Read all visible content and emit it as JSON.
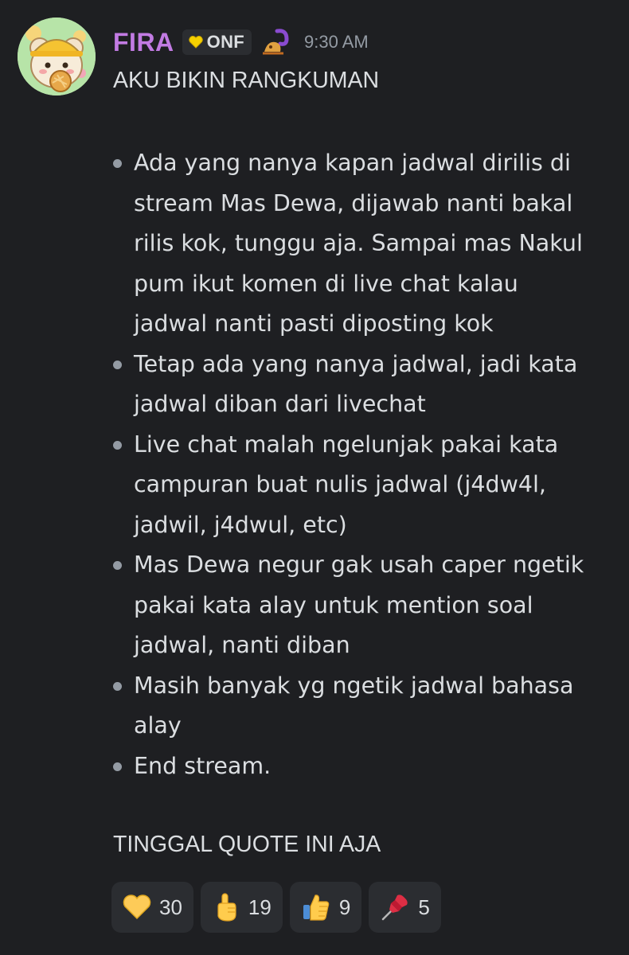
{
  "message": {
    "username": "FIRA",
    "username_color": "#c27be3",
    "clan_tag": "ONF",
    "timestamp": "9:30 AM",
    "heading": "AKU BIKIN RANGKUMAN",
    "bullets": [
      [
        "Ada yang nanya kapan jadwal dirilis di",
        "stream Mas Dewa, dijawab nanti bakal",
        "rilis kok, tunggu aja. Sampai mas Nakul",
        "pum ikut komen di live chat kalau",
        "jadwal nanti pasti diposting kok"
      ],
      [
        "Tetap ada yang nanya jadwal, jadi kata",
        "jadwal diban dari livechat"
      ],
      [
        "Live chat malah ngelunjak pakai kata",
        "campuran buat nulis jadwal (j4dw4l,",
        "jadwil, j4dwul, etc)"
      ],
      [
        "Mas Dewa negur gak usah caper ngetik",
        "pakai kata alay untuk mention soal",
        "jadwal, nanti diban"
      ],
      [
        "Masih banyak yg ngetik jadwal bahasa",
        "alay"
      ],
      [
        "End stream."
      ]
    ],
    "footer": "TINGGAL QUOTE INI AJA"
  },
  "reactions": [
    {
      "emoji": "yellow-heart-icon",
      "count": "30"
    },
    {
      "emoji": "pointing-up-icon",
      "count": "19"
    },
    {
      "emoji": "thumbs-up-icon",
      "count": "9"
    },
    {
      "emoji": "pushpin-icon",
      "count": "5"
    }
  ],
  "colors": {
    "background": "#1e1f22",
    "text": "#dbdee1",
    "muted": "#949ba4",
    "chip": "#2b2d31"
  }
}
